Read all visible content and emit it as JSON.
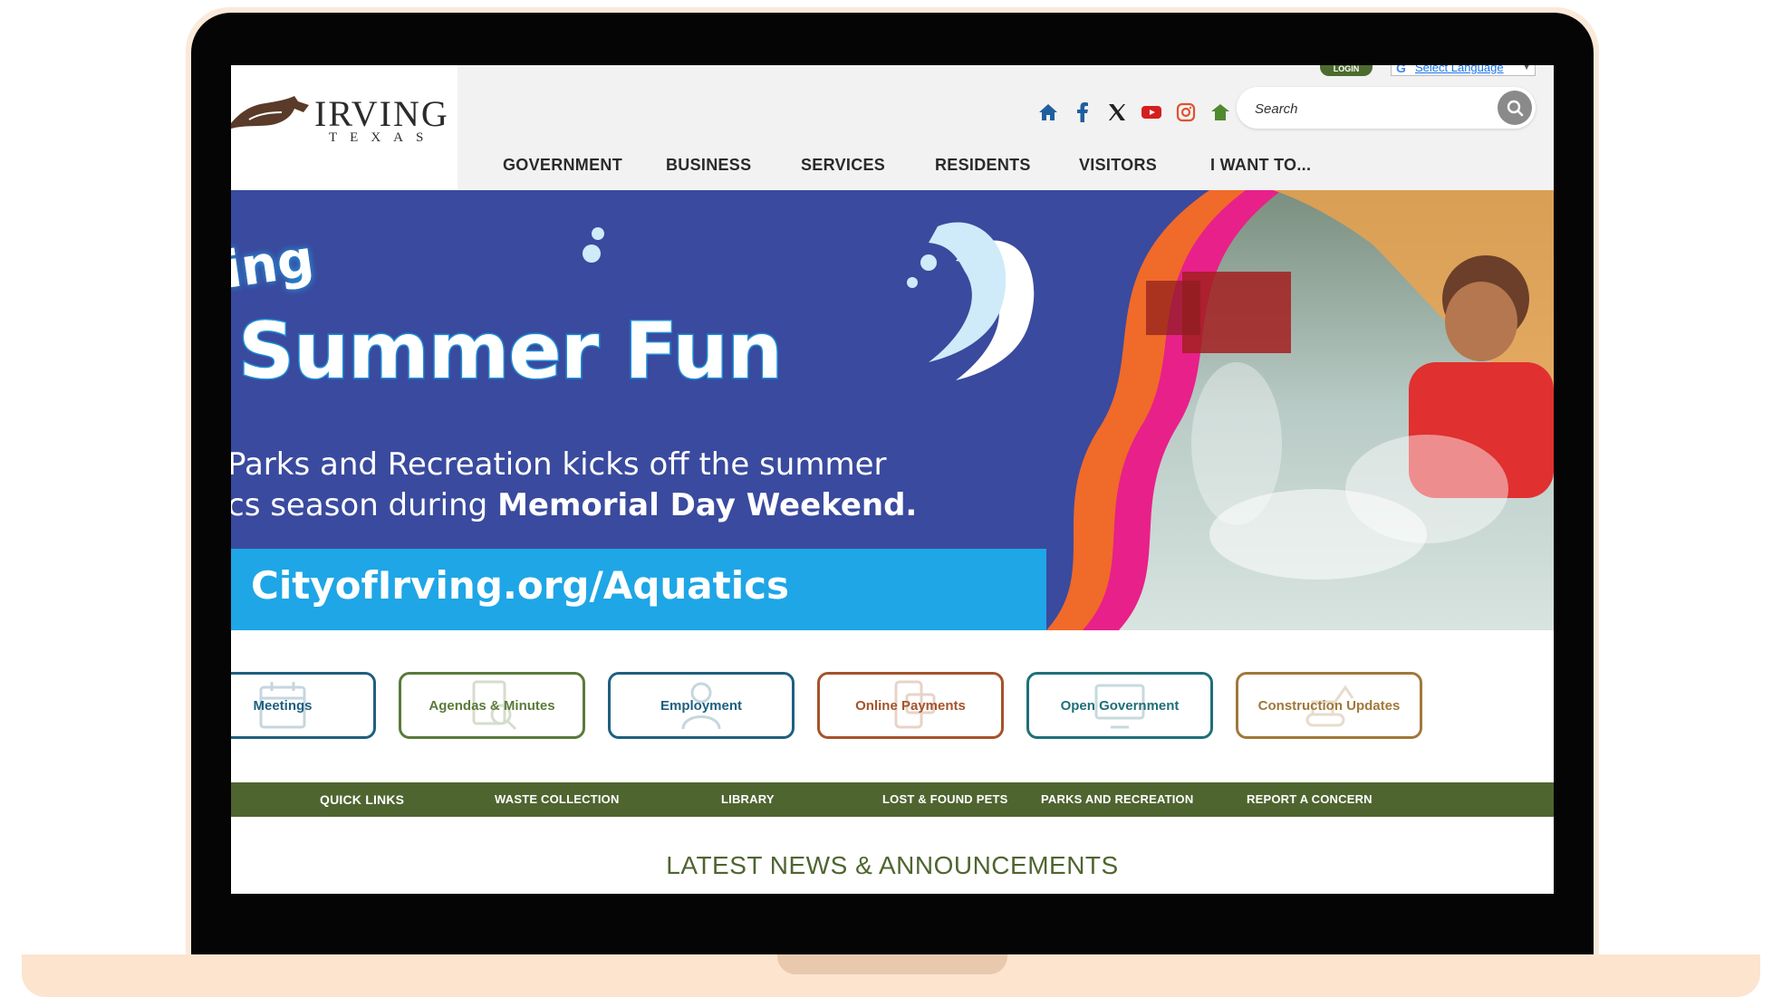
{
  "site": {
    "logo_word": "IRVING",
    "logo_sub": "TEXAS",
    "login_label": "LOGIN",
    "language_label": "Select Language"
  },
  "search": {
    "placeholder": "Search"
  },
  "social_icons": [
    "home-icon",
    "facebook-icon",
    "x-icon",
    "youtube-icon",
    "instagram-icon",
    "nextdoor-icon"
  ],
  "nav": {
    "items": [
      {
        "label": "GOVERNMENT"
      },
      {
        "label": "BUSINESS"
      },
      {
        "label": "SERVICES"
      },
      {
        "label": "RESIDENTS"
      },
      {
        "label": "VISITORS"
      },
      {
        "label": "I WANT TO..."
      }
    ]
  },
  "hero": {
    "small_text": "ing",
    "title": "Summer Fun",
    "line1": "Parks and Recreation kicks off the summer",
    "line2_prefix": "cs season during ",
    "line2_bold": "Memorial Day Weekend.",
    "url": "CityofIrving.org/Aquatics"
  },
  "quick_buttons": [
    {
      "label": "Meetings",
      "color": "#1f5f80"
    },
    {
      "label": "Agendas & Minutes",
      "color": "#5a7a3a"
    },
    {
      "label": "Employment",
      "color": "#1f5f80"
    },
    {
      "label": "Online Payments",
      "color": "#a5532a"
    },
    {
      "label": "Open Government",
      "color": "#1f6f78"
    },
    {
      "label": "Construction Updates",
      "color": "#a0783a"
    }
  ],
  "quick_links": {
    "title": "QUICK LINKS",
    "items": [
      {
        "label": "WASTE COLLECTION"
      },
      {
        "label": "LIBRARY"
      },
      {
        "label": "LOST & FOUND PETS"
      },
      {
        "label": "PARKS AND RECREATION"
      },
      {
        "label": "REPORT A CONCERN"
      }
    ]
  },
  "news": {
    "title": "LATEST NEWS & ANNOUNCEMENTS"
  },
  "colors": {
    "nav_green": "#4f6530",
    "hero_blue": "#3a4a9e",
    "hero_cyan": "#1fa6e6",
    "frame_peach": "#fce4cf"
  }
}
